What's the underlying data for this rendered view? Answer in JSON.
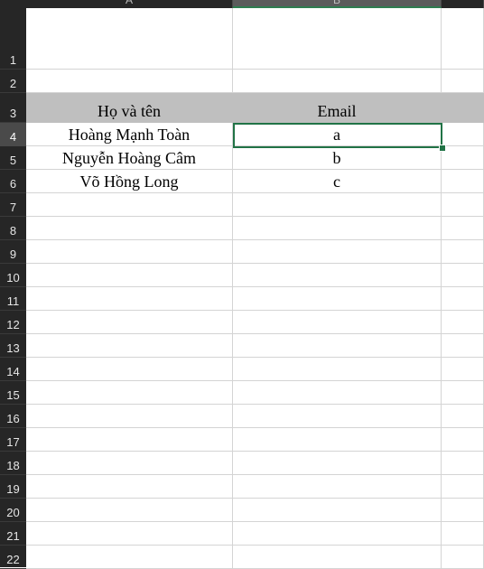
{
  "columns": {
    "a": "A",
    "b": "B"
  },
  "table": {
    "headers": {
      "name": "Họ và tên",
      "email": "Email"
    },
    "rows": [
      {
        "name": "Hoàng Mạnh Toàn",
        "email": "a"
      },
      {
        "name": "Nguyễn Hoàng Câm",
        "email": "b"
      },
      {
        "name": "Võ Hồng Long",
        "email": "c"
      }
    ]
  },
  "row_numbers": [
    "1",
    "2",
    "3",
    "4",
    "5",
    "6",
    "7",
    "8",
    "9",
    "10",
    "11",
    "12",
    "13",
    "14",
    "15",
    "16",
    "17",
    "18",
    "19",
    "20",
    "21",
    "22"
  ],
  "active_row": "4",
  "active_column": "B",
  "colors": {
    "selection": "#217346",
    "header_fill": "#bfbfbf",
    "header_bar": "#262626"
  }
}
